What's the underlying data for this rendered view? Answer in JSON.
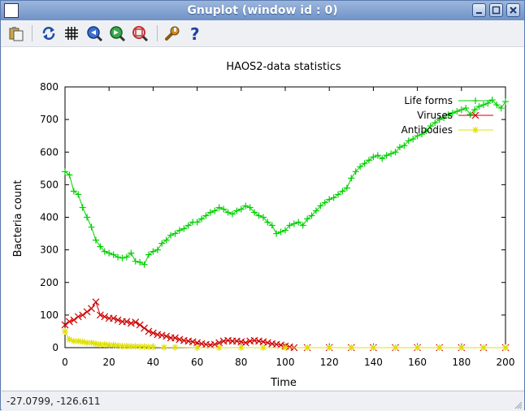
{
  "window": {
    "title": "Gnuplot (window id : 0)",
    "buttons": [
      "minimize-icon",
      "maximize-icon",
      "close-icon"
    ]
  },
  "toolbar": {
    "icons": [
      "copy-to-clipboard-icon",
      "replot-icon",
      "grid-icon",
      "previous-zoom-icon",
      "next-zoom-icon",
      "autoscale-icon",
      "settings-wrench-icon",
      "help-icon"
    ]
  },
  "status": {
    "coords": "-27.0799, -126.611"
  },
  "colors": {
    "life": "#00d000",
    "viruses": "#d00000",
    "antibodies": "#e0e000",
    "accent": "#6f92c6"
  },
  "chart_data": {
    "type": "line",
    "title": "HAOS2-data statistics",
    "xlabel": "Time",
    "ylabel": "Bacteria count",
    "xlim": [
      0,
      200
    ],
    "ylim": [
      0,
      800
    ],
    "xticks": [
      "0",
      "20",
      "40",
      "60",
      "80",
      "100",
      "120",
      "140",
      "160",
      "180",
      "200"
    ],
    "yticks": [
      "0",
      "100",
      "200",
      "300",
      "400",
      "500",
      "600",
      "700",
      "800"
    ],
    "legend_position": "top-right",
    "grid": false,
    "series": [
      {
        "name": "Life forms",
        "points": [
          [
            0,
            540
          ],
          [
            2,
            530
          ],
          [
            4,
            480
          ],
          [
            6,
            470
          ],
          [
            8,
            430
          ],
          [
            10,
            400
          ],
          [
            12,
            370
          ],
          [
            14,
            330
          ],
          [
            16,
            310
          ],
          [
            18,
            295
          ],
          [
            20,
            290
          ],
          [
            22,
            285
          ],
          [
            24,
            278
          ],
          [
            26,
            275
          ],
          [
            28,
            278
          ],
          [
            30,
            290
          ],
          [
            32,
            265
          ],
          [
            34,
            262
          ],
          [
            36,
            255
          ],
          [
            38,
            285
          ],
          [
            40,
            295
          ],
          [
            42,
            300
          ],
          [
            44,
            320
          ],
          [
            46,
            330
          ],
          [
            48,
            345
          ],
          [
            50,
            350
          ],
          [
            52,
            360
          ],
          [
            54,
            365
          ],
          [
            56,
            375
          ],
          [
            58,
            385
          ],
          [
            60,
            385
          ],
          [
            62,
            395
          ],
          [
            64,
            405
          ],
          [
            66,
            415
          ],
          [
            68,
            420
          ],
          [
            70,
            430
          ],
          [
            72,
            425
          ],
          [
            74,
            415
          ],
          [
            76,
            410
          ],
          [
            78,
            420
          ],
          [
            80,
            425
          ],
          [
            82,
            435
          ],
          [
            84,
            430
          ],
          [
            86,
            415
          ],
          [
            88,
            405
          ],
          [
            90,
            400
          ],
          [
            92,
            385
          ],
          [
            94,
            375
          ],
          [
            96,
            350
          ],
          [
            98,
            355
          ],
          [
            100,
            360
          ],
          [
            102,
            375
          ],
          [
            104,
            380
          ],
          [
            106,
            385
          ],
          [
            108,
            375
          ],
          [
            110,
            395
          ],
          [
            112,
            405
          ],
          [
            114,
            420
          ],
          [
            116,
            435
          ],
          [
            118,
            445
          ],
          [
            120,
            455
          ],
          [
            122,
            460
          ],
          [
            124,
            470
          ],
          [
            126,
            480
          ],
          [
            128,
            490
          ],
          [
            130,
            520
          ],
          [
            132,
            540
          ],
          [
            134,
            555
          ],
          [
            136,
            565
          ],
          [
            138,
            575
          ],
          [
            140,
            585
          ],
          [
            142,
            590
          ],
          [
            144,
            580
          ],
          [
            146,
            590
          ],
          [
            148,
            595
          ],
          [
            150,
            600
          ],
          [
            152,
            615
          ],
          [
            154,
            620
          ],
          [
            156,
            635
          ],
          [
            158,
            640
          ],
          [
            160,
            650
          ],
          [
            162,
            655
          ],
          [
            164,
            665
          ],
          [
            166,
            680
          ],
          [
            168,
            690
          ],
          [
            170,
            700
          ],
          [
            172,
            705
          ],
          [
            174,
            715
          ],
          [
            176,
            720
          ],
          [
            178,
            725
          ],
          [
            180,
            730
          ],
          [
            182,
            735
          ],
          [
            184,
            715
          ],
          [
            186,
            730
          ],
          [
            188,
            740
          ],
          [
            190,
            745
          ],
          [
            192,
            750
          ],
          [
            194,
            760
          ],
          [
            196,
            745
          ],
          [
            198,
            735
          ],
          [
            200,
            755
          ]
        ]
      },
      {
        "name": "Viruses",
        "points": [
          [
            0,
            70
          ],
          [
            2,
            80
          ],
          [
            4,
            85
          ],
          [
            6,
            95
          ],
          [
            8,
            100
          ],
          [
            10,
            110
          ],
          [
            12,
            120
          ],
          [
            14,
            140
          ],
          [
            16,
            100
          ],
          [
            18,
            95
          ],
          [
            20,
            90
          ],
          [
            22,
            90
          ],
          [
            24,
            85
          ],
          [
            26,
            80
          ],
          [
            28,
            80
          ],
          [
            30,
            75
          ],
          [
            32,
            78
          ],
          [
            34,
            70
          ],
          [
            36,
            60
          ],
          [
            38,
            50
          ],
          [
            40,
            45
          ],
          [
            42,
            40
          ],
          [
            44,
            38
          ],
          [
            46,
            35
          ],
          [
            48,
            30
          ],
          [
            50,
            30
          ],
          [
            52,
            25
          ],
          [
            54,
            22
          ],
          [
            56,
            20
          ],
          [
            58,
            18
          ],
          [
            60,
            15
          ],
          [
            62,
            12
          ],
          [
            64,
            10
          ],
          [
            66,
            8
          ],
          [
            68,
            10
          ],
          [
            70,
            15
          ],
          [
            72,
            20
          ],
          [
            74,
            22
          ],
          [
            76,
            20
          ],
          [
            78,
            20
          ],
          [
            80,
            18
          ],
          [
            82,
            15
          ],
          [
            84,
            20
          ],
          [
            86,
            22
          ],
          [
            88,
            20
          ],
          [
            90,
            18
          ],
          [
            92,
            15
          ],
          [
            94,
            12
          ],
          [
            96,
            10
          ],
          [
            98,
            8
          ],
          [
            100,
            5
          ],
          [
            102,
            2
          ],
          [
            104,
            0
          ],
          [
            110,
            0
          ],
          [
            120,
            0
          ],
          [
            130,
            0
          ],
          [
            140,
            0
          ],
          [
            150,
            0
          ],
          [
            160,
            0
          ],
          [
            170,
            0
          ],
          [
            180,
            0
          ],
          [
            190,
            0
          ],
          [
            200,
            0
          ]
        ]
      },
      {
        "name": "Antibodies",
        "points": [
          [
            0,
            50
          ],
          [
            2,
            25
          ],
          [
            4,
            20
          ],
          [
            6,
            20
          ],
          [
            8,
            18
          ],
          [
            10,
            15
          ],
          [
            12,
            15
          ],
          [
            14,
            12
          ],
          [
            16,
            10
          ],
          [
            18,
            10
          ],
          [
            20,
            8
          ],
          [
            22,
            8
          ],
          [
            24,
            6
          ],
          [
            26,
            5
          ],
          [
            28,
            5
          ],
          [
            30,
            4
          ],
          [
            32,
            4
          ],
          [
            34,
            3
          ],
          [
            36,
            3
          ],
          [
            38,
            2
          ],
          [
            40,
            2
          ],
          [
            45,
            1
          ],
          [
            50,
            1
          ],
          [
            60,
            0
          ],
          [
            70,
            0
          ],
          [
            80,
            0
          ],
          [
            90,
            0
          ],
          [
            100,
            0
          ],
          [
            110,
            0
          ],
          [
            120,
            0
          ],
          [
            130,
            0
          ],
          [
            140,
            0
          ],
          [
            150,
            0
          ],
          [
            160,
            0
          ],
          [
            170,
            0
          ],
          [
            180,
            0
          ],
          [
            190,
            0
          ],
          [
            200,
            0
          ]
        ]
      }
    ]
  }
}
